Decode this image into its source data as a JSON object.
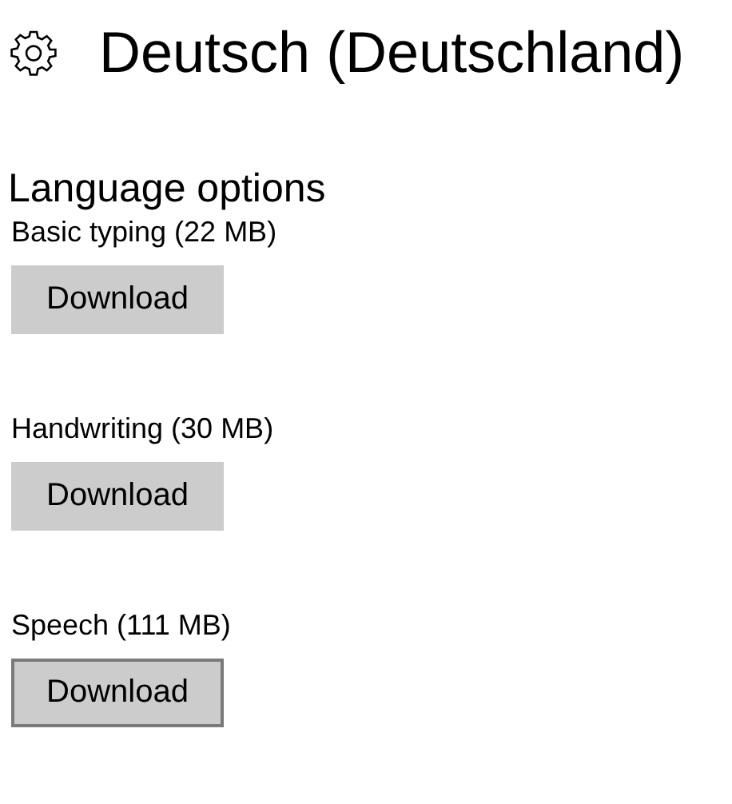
{
  "header": {
    "title": "Deutsch (Deutschland)"
  },
  "section": {
    "title": "Language options"
  },
  "options": [
    {
      "label": "Basic typing (22 MB)",
      "button": "Download",
      "focused": false
    },
    {
      "label": "Handwriting (30 MB)",
      "button": "Download",
      "focused": false
    },
    {
      "label": "Speech (111 MB)",
      "button": "Download",
      "focused": true
    }
  ]
}
